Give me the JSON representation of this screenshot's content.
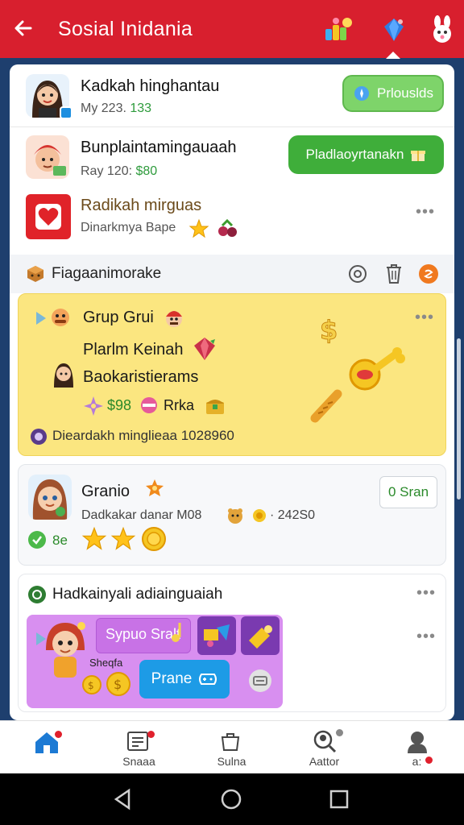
{
  "appbar": {
    "title": "Sosial Inidania",
    "back_icon": "arrow-left-icon",
    "icons": [
      "people-group-icon",
      "blue-gem-icon",
      "cartoon-bunny-icon"
    ]
  },
  "accounts": [
    {
      "name": "Kadkah hinghantau",
      "detail": "My 223.",
      "amount": "133",
      "button": "Prlouslds"
    },
    {
      "name": "Bunplaintamingauaah",
      "detail": "Ray 120:",
      "amount": "$80",
      "button": "Pladlaoyrtanakn"
    },
    {
      "name": "Radikah mirguas",
      "detail": "Dinarkmya Bape",
      "more": "•••"
    }
  ],
  "section": {
    "title": "Fiagaanimorake",
    "icons": [
      "info-circle-icon",
      "trash-icon",
      "orange-badge-icon"
    ]
  },
  "group_card": {
    "title": "Grup Grui",
    "line1": "Plarlm Keinah",
    "line2": "Baokaristierams",
    "price": "$98",
    "tag": "Rrka",
    "footer": "Dieardakh minglieaa 1028960",
    "more": "•••"
  },
  "profile_card": {
    "name": "Granio",
    "detail": "Dadkakar danar M08",
    "value": "242S0",
    "button": "0 Sran",
    "badge": "8e"
  },
  "promo_card": {
    "title": "Hadkainyali adiainguaiah",
    "more1": "•••",
    "more2": "•••",
    "banner_label": "Sypuo Sralt",
    "small_label": "Sheqfa",
    "button": "Prane"
  },
  "bottom_nav": [
    {
      "label": "",
      "icon": "home-icon"
    },
    {
      "label": "Snaaa",
      "icon": "news-icon"
    },
    {
      "label": "Sulna",
      "icon": "shop-icon"
    },
    {
      "label": "Aattor",
      "icon": "search-person-icon"
    },
    {
      "label": "a:",
      "icon": "profile-icon"
    }
  ],
  "colors": {
    "appbar": "#d81f2e",
    "accent_green": "#3fae3a",
    "accent_blue": "#1d9be6",
    "card_yellow": "#fbe680",
    "banner_purple": "#c86fe6"
  }
}
